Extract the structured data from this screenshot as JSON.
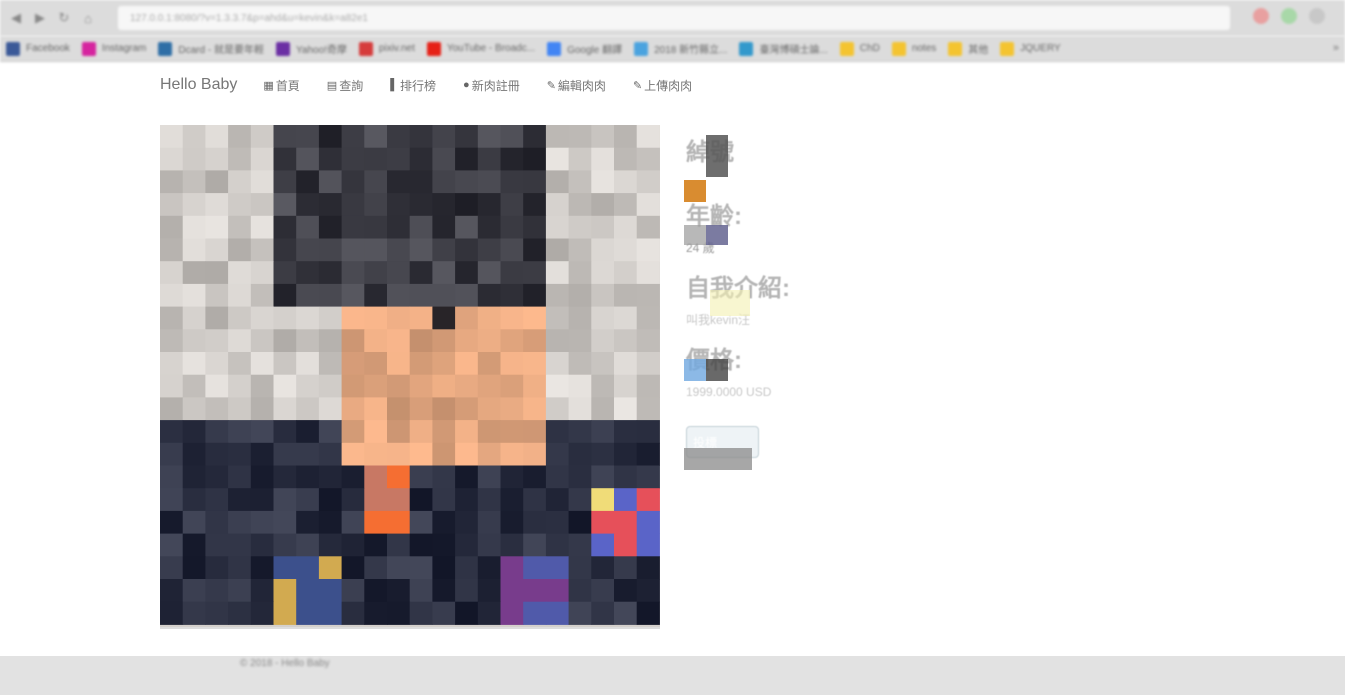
{
  "browser": {
    "address": "127.0.0.1:8080/?v=1.3.3.7&p=ahd&u=kevin&k=a82e1",
    "bookmarks": [
      {
        "label": "Facebook",
        "color": "#3b5998"
      },
      {
        "label": "Instagram",
        "color": "#d6249f"
      },
      {
        "label": "Dcard - 就是要年輕",
        "color": "#2e6ea6"
      },
      {
        "label": "Yahoo!奇摩",
        "color": "#6b2fa4"
      },
      {
        "label": "pixiv.net",
        "color": "#d63c3c"
      },
      {
        "label": "YouTube - Broadc...",
        "color": "#e62117"
      },
      {
        "label": "Google 翻譯",
        "color": "#4285f4"
      },
      {
        "label": "2018 新竹縣立...",
        "color": "#4aa3df"
      },
      {
        "label": "臺灣博碩士論...",
        "color": "#3399cc"
      },
      {
        "label": "ChD",
        "color": "#f4c430"
      },
      {
        "label": "notes",
        "color": "#f4c430"
      },
      {
        "label": "其他",
        "color": "#f4c430"
      },
      {
        "label": "JQUERY",
        "color": "#f4c430"
      }
    ],
    "overflow_label": "»"
  },
  "navbar": {
    "brand": "Hello Baby",
    "items": [
      {
        "icon": "grid-icon",
        "glyph": "▦",
        "label": "首頁"
      },
      {
        "icon": "list-icon",
        "glyph": "▤",
        "label": "查詢"
      },
      {
        "icon": "bar-chart-icon",
        "glyph": "▌",
        "label": "排行榜"
      },
      {
        "icon": "user-icon",
        "glyph": "●",
        "label": "新肉註冊"
      },
      {
        "icon": "pencil-icon",
        "glyph": "✎",
        "label": "編輯肉肉"
      },
      {
        "icon": "pencil-icon",
        "glyph": "✎",
        "label": "上傳肉肉"
      }
    ]
  },
  "profile": {
    "name_title": "綽號",
    "age_title": "年齡:",
    "age_value": "24 歲",
    "intro_title": "自我介紹:",
    "intro_value": "叫我kevin汪",
    "price_title": "價格:",
    "price_value": "1999.0000 USD",
    "bid_button": "投標"
  },
  "footer": {
    "text": "© 2018 - Hello Baby"
  }
}
